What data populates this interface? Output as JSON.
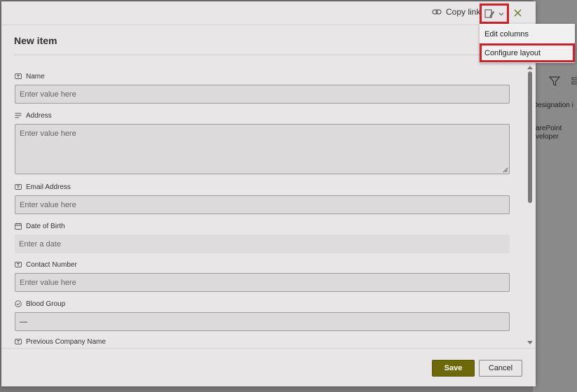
{
  "background": {
    "column_header": "Designation i",
    "cell_line1": "arePoint",
    "cell_line2": "veloper",
    "filter_icon": "filter-icon",
    "columns_icon": "columns-icon"
  },
  "topbar": {
    "copy_link_label": "Copy link",
    "copy_link_icon": "link-icon",
    "layout_icon": "edit-form-icon",
    "dropdown_icon": "chevron-down-icon",
    "close_icon": "close-icon"
  },
  "header": {
    "title": "New item"
  },
  "fields": [
    {
      "label": "Name",
      "icon": "text-icon",
      "placeholder": "Enter value here"
    },
    {
      "label": "Address",
      "icon": "multiline-text-icon",
      "placeholder": "Enter value here"
    },
    {
      "label": "Email Address",
      "icon": "text-icon",
      "placeholder": "Enter value here"
    },
    {
      "label": "Date of Birth",
      "icon": "calendar-icon",
      "placeholder": "Enter a date"
    },
    {
      "label": "Contact Number",
      "icon": "text-icon",
      "placeholder": "Enter value here"
    },
    {
      "label": "Blood Group",
      "icon": "choice-icon",
      "value": "—"
    },
    {
      "label": "Previous Company Name",
      "icon": "text-icon",
      "placeholder": ""
    }
  ],
  "footer": {
    "save_label": "Save",
    "cancel_label": "Cancel"
  },
  "menu": {
    "items": [
      {
        "label": "Edit columns"
      },
      {
        "label": "Configure layout"
      }
    ]
  },
  "colors": {
    "accent": "#6e6908",
    "highlight": "#d5202a"
  }
}
